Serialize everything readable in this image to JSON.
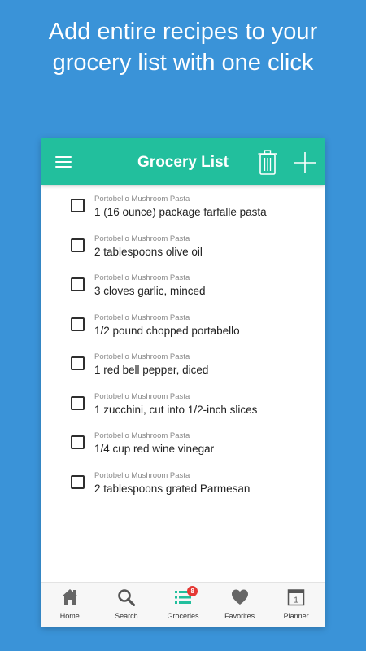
{
  "headline": {
    "line1": "Add entire recipes to your",
    "line2": "grocery list with one click"
  },
  "appbar": {
    "title": "Grocery List",
    "icons": [
      "menu-icon",
      "trash-icon",
      "plus-icon"
    ]
  },
  "list": {
    "items": [
      {
        "source": "Portobello Mushroom Pasta",
        "text": "1 (16 ounce) package farfalle pasta",
        "checked": false
      },
      {
        "source": "Portobello Mushroom Pasta",
        "text": "2 tablespoons olive oil",
        "checked": false
      },
      {
        "source": "Portobello Mushroom Pasta",
        "text": "3 cloves garlic, minced",
        "checked": false
      },
      {
        "source": "Portobello Mushroom Pasta",
        "text": "1/2 pound chopped portabello",
        "checked": false
      },
      {
        "source": "Portobello Mushroom Pasta",
        "text": "1 red bell pepper, diced",
        "checked": false
      },
      {
        "source": "Portobello Mushroom Pasta",
        "text": "1 zucchini, cut into 1/2-inch slices",
        "checked": false
      },
      {
        "source": "Portobello Mushroom Pasta",
        "text": "1/4 cup red wine vinegar",
        "checked": false
      },
      {
        "source": "Portobello Mushroom Pasta",
        "text": "2 tablespoons grated Parmesan",
        "checked": false
      }
    ]
  },
  "tabbar": {
    "tabs": [
      {
        "label": "Home",
        "icon": "home-icon"
      },
      {
        "label": "Search",
        "icon": "search-icon"
      },
      {
        "label": "Groceries",
        "icon": "list-icon",
        "badge": "8"
      },
      {
        "label": "Favorites",
        "icon": "heart-icon"
      },
      {
        "label": "Planner",
        "icon": "calendar-icon",
        "icon_text": "1"
      }
    ]
  },
  "colors": {
    "background": "#3a93d8",
    "appbar": "#22bf9d",
    "badge": "#e53935"
  }
}
